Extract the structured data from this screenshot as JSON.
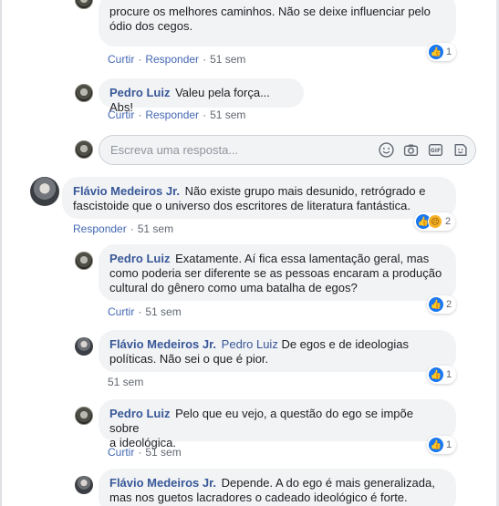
{
  "comments": [
    {
      "id": "c0",
      "text_line1": "procure os melhores caminhos. Não se deixe influenciar pelo",
      "text_line2": "ódio dos cegos.",
      "reaction_count": "1",
      "actions": [
        "Curtir",
        "Responder",
        "51 sem"
      ]
    },
    {
      "id": "c1",
      "author": "Pedro Luiz",
      "text": "Valeu pela força... Abs!",
      "actions": [
        "Curtir",
        "Responder",
        "51 sem"
      ]
    },
    {
      "id": "c2",
      "author": "Flávio Medeiros Jr.",
      "text_line1": "Não existe grupo mais desunido, retrógrado e",
      "text_line2": "fascistoide que o universo dos escritores de literatura fantástica.",
      "reaction_count": "2",
      "actions": [
        "Responder",
        "51 sem"
      ]
    },
    {
      "id": "c3",
      "author": "Pedro Luiz",
      "text_line1": "Exatamente. Aí fica essa lamentação geral, mas",
      "text_line2": "como poderia ser diferente se as pessoas encaram a produção",
      "text_line3": "cultural do gênero como uma batalha de egos?",
      "reaction_count": "2",
      "actions": [
        "Curtir",
        "51 sem"
      ]
    },
    {
      "id": "c4",
      "author": "Flávio Medeiros Jr.",
      "mention": "Pedro Luiz",
      "text_line1": "De egos e de ideologias",
      "text_line2": "políticas. Não sei o que é pior.",
      "reaction_count": "1",
      "actions": [
        "51 sem"
      ]
    },
    {
      "id": "c5",
      "author": "Pedro Luiz",
      "text_line1": "Pelo que eu vejo, a questão do ego se impõe sobre",
      "text_line2": "a ideológica.",
      "reaction_count": "1",
      "actions": [
        "Curtir",
        "51 sem"
      ]
    },
    {
      "id": "c6",
      "author": "Flávio Medeiros Jr.",
      "text_line1": "Depende. A do ego é mais generalizada,",
      "text_line2": "mas nos guetos lacradores o cadeado ideológico é forte."
    }
  ],
  "reply_box": {
    "placeholder": "Escreva uma resposta...",
    "icons": [
      "emoji-icon",
      "camera-icon",
      "gif-icon",
      "sticker-icon"
    ]
  },
  "colors": {
    "link": "#385898",
    "action": "#4267b2",
    "bubble": "#f2f3f5",
    "like": "#1877f2"
  }
}
